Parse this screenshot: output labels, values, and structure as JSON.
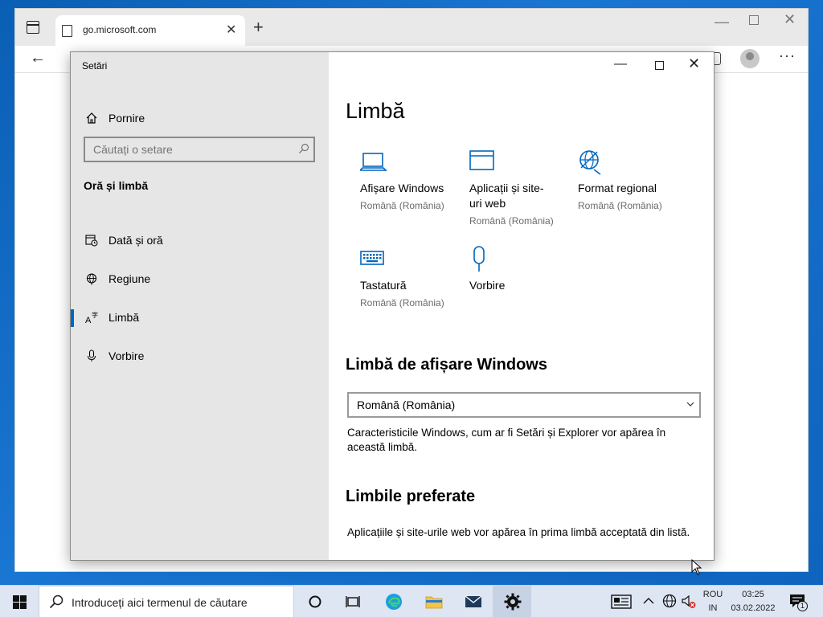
{
  "browser": {
    "tab_title": "go.microsoft.com",
    "tab_close": "✕",
    "new_tab": "+",
    "back": "←",
    "more": "···"
  },
  "settings": {
    "app_title": "Setări",
    "home_label": "Pornire",
    "search_placeholder": "Căutați o setare",
    "section_title": "Oră și limbă",
    "nav": [
      {
        "label": "Dată și oră",
        "icon": "calendar-clock-icon"
      },
      {
        "label": "Regiune",
        "icon": "globe-icon"
      },
      {
        "label": "Limbă",
        "icon": "language-icon"
      },
      {
        "label": "Vorbire",
        "icon": "microphone-icon"
      }
    ],
    "active_nav": "Limbă",
    "accent_color": "#0067c0",
    "page_title": "Limbă",
    "tiles": [
      {
        "name": "Afișare Windows",
        "sub": "Română (România)",
        "icon": "laptop-icon"
      },
      {
        "name": "Aplicații și site-uri web",
        "sub": "Română (România)",
        "icon": "window-icon"
      },
      {
        "name": "Format regional",
        "sub": "Română (România)",
        "icon": "regional-globe-icon"
      },
      {
        "name": "Tastatură",
        "sub": "Română (România)",
        "icon": "keyboard-icon"
      },
      {
        "name": "Vorbire",
        "sub": "",
        "icon": "microphone-icon"
      }
    ],
    "display_lang_title": "Limbă de afișare Windows",
    "display_lang_value": "Română (România)",
    "display_lang_desc": "Caracteristicile Windows, cum ar fi Setări și Explorer vor apărea în această limbă.",
    "preferred_title": "Limbile preferate",
    "preferred_desc": "Aplicațiile și site-urile web vor apărea în prima limbă acceptată din listă."
  },
  "taskbar": {
    "search_placeholder": "Introduceți aici termenul de căutare",
    "lang_top": "ROU",
    "lang_bottom": "IN",
    "time": "03:25",
    "date": "03.02.2022",
    "notification_count": "1"
  }
}
